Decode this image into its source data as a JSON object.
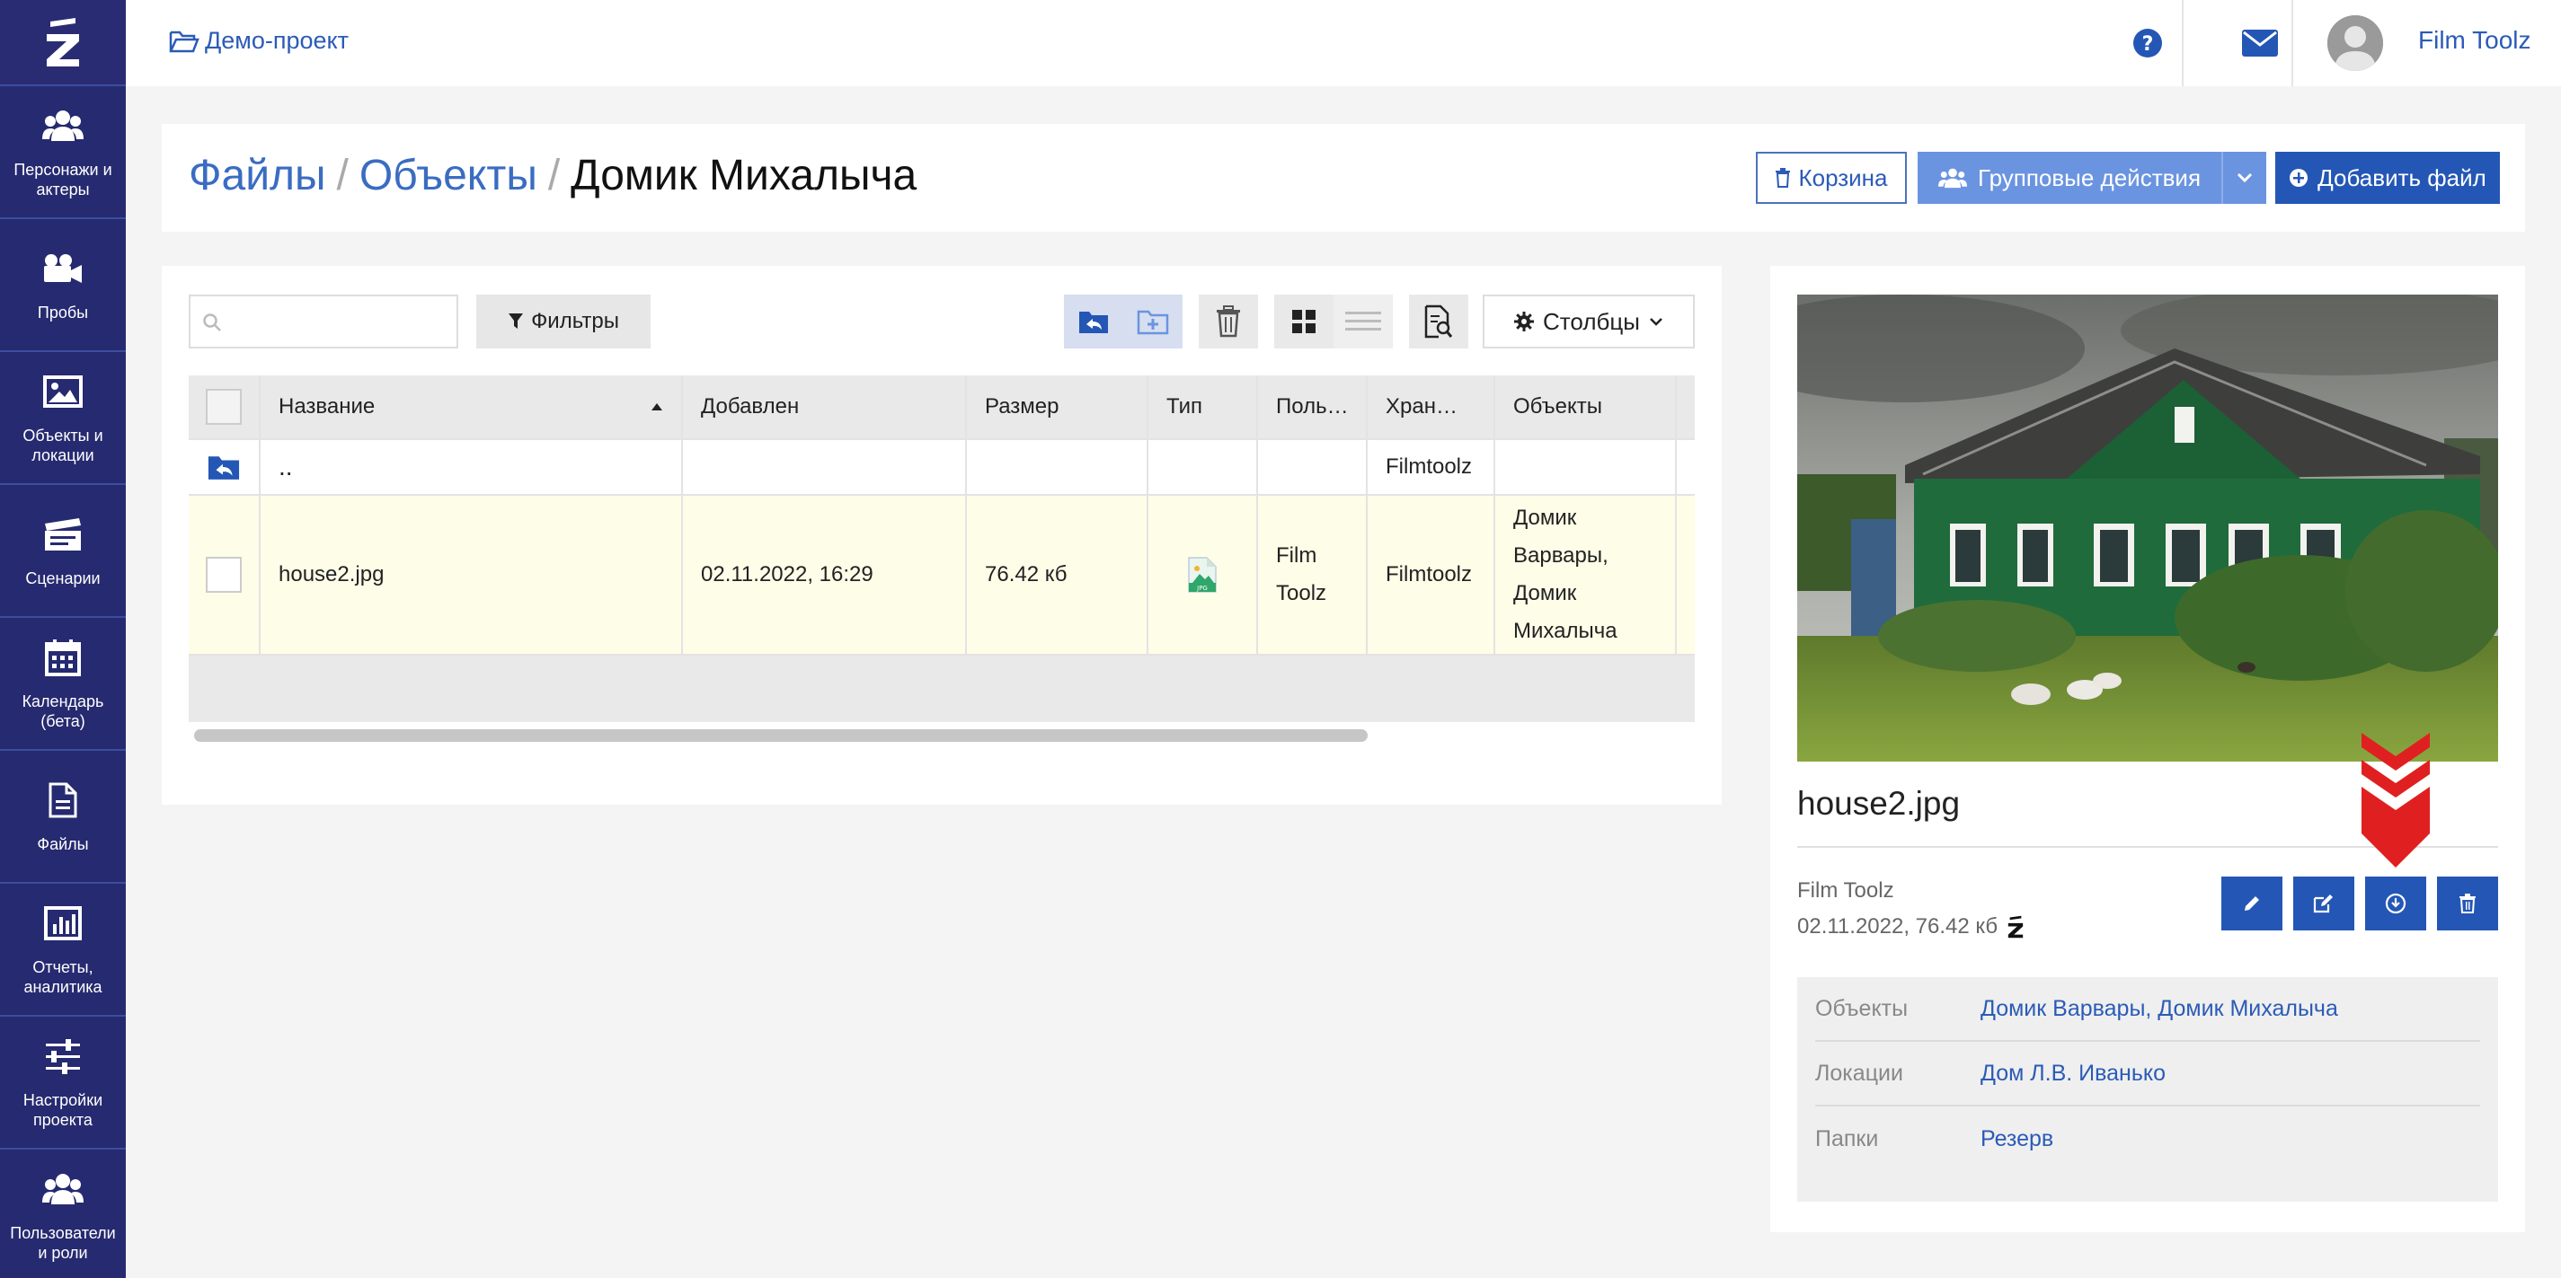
{
  "sidebar": {
    "items": [
      {
        "label": "Персонажи и актеры",
        "icon": "users-icon"
      },
      {
        "label": "Пробы",
        "icon": "video-camera-icon"
      },
      {
        "label": "Объекты и локации",
        "icon": "image-icon"
      },
      {
        "label": "Сценарии",
        "icon": "clapperboard-icon"
      },
      {
        "label": "Календарь (бета)",
        "icon": "calendar-icon"
      },
      {
        "label": "Файлы",
        "icon": "file-icon"
      },
      {
        "label": "Отчеты, аналитика",
        "icon": "bar-chart-icon"
      },
      {
        "label": "Настройки проекта",
        "icon": "sliders-icon"
      },
      {
        "label": "Пользователи и роли",
        "icon": "users-icon"
      }
    ]
  },
  "topbar": {
    "project": "Демо-проект",
    "user_name": "Film Toolz"
  },
  "header": {
    "breadcrumb": [
      "Файлы",
      "Объекты",
      "Домик Михалыча"
    ],
    "trash_label": "Корзина",
    "group_actions_label": "Групповые действия",
    "add_file_label": "Добавить файл"
  },
  "toolbar": {
    "search_placeholder": "",
    "filters_label": "Фильтры",
    "columns_label": "Столбцы"
  },
  "table": {
    "columns": [
      "Название",
      "Добавлен",
      "Размер",
      "Тип",
      "Поль…",
      "Хран…",
      "Объекты"
    ],
    "up_row": {
      "name": "..",
      "storage": "Filmtoolz"
    },
    "rows": [
      {
        "name": "house2.jpg",
        "added": "02.11.2022, 16:29",
        "size": "76.42 кб",
        "type": "JPG",
        "user_line1": "Film",
        "user_line2": "Toolz",
        "storage": "Filmtoolz",
        "objects_line1": "Домик",
        "objects_line2": "Варвары,",
        "objects_line3": "Домик",
        "objects_line4": "Михалыча"
      }
    ]
  },
  "detail": {
    "file_name": "house2.jpg",
    "author": "Film Toolz",
    "date_size": "02.11.2022, 76.42 кб",
    "info": [
      {
        "key": "Объекты",
        "value": "Домик Варвары, Домик Михалыча"
      },
      {
        "key": "Локации",
        "value": "Дом Л.В. Иванько"
      },
      {
        "key": "Папки",
        "value": "Резерв"
      }
    ]
  },
  "colors": {
    "sidebar_bg": "#2b2f7d",
    "primary": "#2457b5",
    "link": "#2b5bb7",
    "group_btn": "#6b94e0",
    "selected_row": "#fefde8",
    "highlight_arrow": "#e02020"
  }
}
